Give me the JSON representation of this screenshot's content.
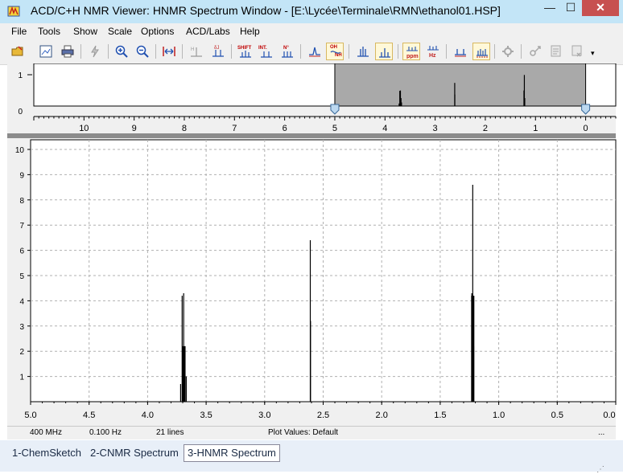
{
  "window": {
    "title": "ACD/C+H NMR Viewer: HNMR Spectrum Window - [E:\\Lycée\\Terminale\\RMN\\ethanol01.HSP]"
  },
  "menu": [
    {
      "label": "File"
    },
    {
      "label": "Tools"
    },
    {
      "label": "Show"
    },
    {
      "label": "Scale"
    },
    {
      "label": "Options"
    },
    {
      "label": "ACD/Labs"
    },
    {
      "label": "Help"
    }
  ],
  "toolbar": {
    "shift_label": "SHIFT",
    "int_label": "INT.",
    "nh_label": "N°",
    "oh_label": "OH",
    "nh2_label": "NH",
    "ppm_label": "ppm",
    "hz_label": "Hz",
    "more_label": "▾"
  },
  "overview": {
    "y_ticks": [
      "1",
      "0"
    ],
    "x_ticks": [
      "10",
      "9",
      "8",
      "7",
      "6",
      "5",
      "4",
      "3",
      "2",
      "1",
      "0"
    ],
    "selection_range_ppm": [
      5.0,
      0.0
    ]
  },
  "chart_data": {
    "type": "line",
    "title": "",
    "xlabel": "",
    "ylabel": "",
    "xlim": [
      5.0,
      0.0
    ],
    "ylim": [
      0,
      10
    ],
    "x_ticks": [
      "5.0",
      "4.5",
      "4.0",
      "3.5",
      "3.0",
      "2.5",
      "2.0",
      "1.5",
      "1.0",
      "0.5",
      "0.0"
    ],
    "y_ticks": [
      "1",
      "2",
      "3",
      "4",
      "5",
      "6",
      "7",
      "8",
      "9",
      "10"
    ],
    "grid": true,
    "peaks": [
      {
        "ppm": 3.718,
        "height": 0.7
      },
      {
        "ppm": 3.705,
        "height": 4.2
      },
      {
        "ppm": 3.692,
        "height": 4.3
      },
      {
        "ppm": 3.68,
        "height": 2.2
      },
      {
        "ppm": 3.67,
        "height": 1.0
      },
      {
        "ppm": 2.61,
        "height": 6.4
      },
      {
        "ppm": 2.608,
        "height": 3.2
      },
      {
        "ppm": 1.23,
        "height": 4.3
      },
      {
        "ppm": 1.222,
        "height": 8.6
      },
      {
        "ppm": 1.214,
        "height": 2.2
      }
    ]
  },
  "status": {
    "frequency": "400 MHz",
    "resolution": "0.100 Hz",
    "lines": "21 lines",
    "plot_values": "Plot Values: Default",
    "extra": "..."
  },
  "tabs": [
    {
      "label": "1-ChemSketch"
    },
    {
      "label": "2-CNMR Spectrum"
    },
    {
      "label": "3-HNMR Spectrum"
    }
  ],
  "colors": {
    "titlebar": "#c3e5f7",
    "selection": "#a9a9a9",
    "close": "#c75050"
  }
}
